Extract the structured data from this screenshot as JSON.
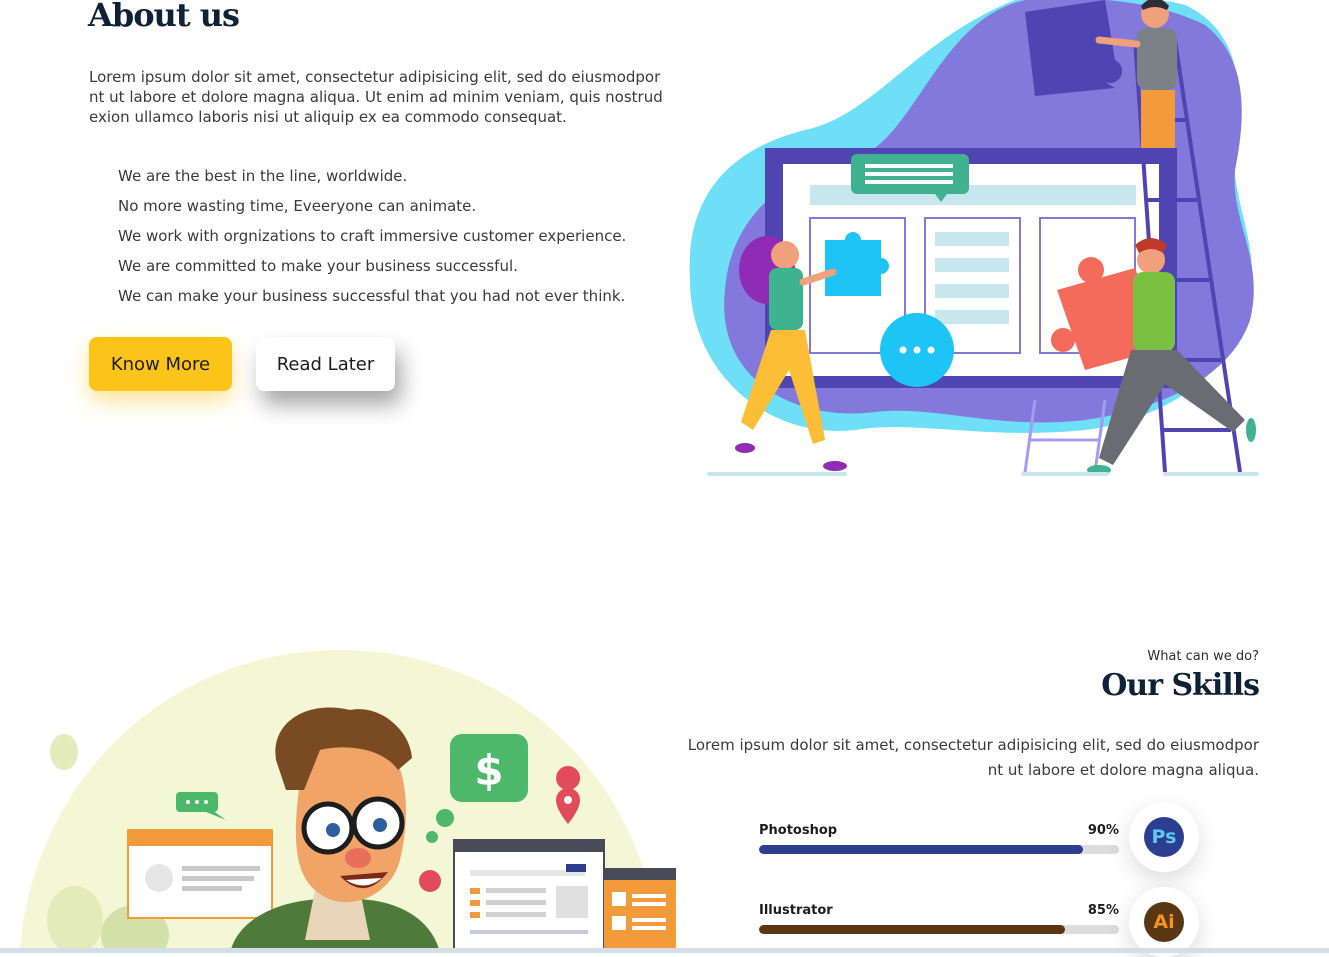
{
  "about": {
    "title": "About us",
    "lead": "Lorem ipsum dolor sit amet, consectetur adipisicing elit, sed do eiusmodpor nt ut labore et dolore magna aliqua. Ut enim ad minim veniam, quis nostrud exion ullamco laboris nisi ut aliquip ex ea commodo consequat.",
    "points": [
      "We are the best in the line, worldwide.",
      "No more wasting time, Eveeryone can animate.",
      "We work with orgnizations to craft immersive customer experience.",
      "We are committed to make your business successful.",
      "We can make your business successful that you had not ever think."
    ],
    "buttons": {
      "primary": "Know More",
      "secondary": "Read Later"
    }
  },
  "skills": {
    "kicker": "What can we do?",
    "title": "Our Skills",
    "lead": "Lorem ipsum dolor sit amet, consectetur adipisicing elit, sed do eiusmodpor nt ut labore et dolore magna aliqua.",
    "items": [
      {
        "name": "Photoshop",
        "percent_label": "90%",
        "level": 0.9,
        "bar_color": "#2b3e8f",
        "icon_label": "Ps",
        "icon_bg": "#2b3e8f",
        "icon_fg": "#5fc8f5",
        "icon_name": "photoshop-icon"
      },
      {
        "name": "Illustrator",
        "percent_label": "85%",
        "level": 0.85,
        "bar_color": "#5a3713",
        "icon_label": "Ai",
        "icon_bg": "#5a3713",
        "icon_fg": "#f7931e",
        "icon_name": "illustrator-icon"
      }
    ]
  },
  "colors": {
    "accent_yellow": "#fcc419",
    "heading_navy": "#0d2137",
    "blob_purple": "#8378db",
    "blob_cyan": "#6fdff7"
  },
  "illustrations": {
    "top": "team-puzzle-illustration",
    "bottom": "developer-illustration"
  }
}
